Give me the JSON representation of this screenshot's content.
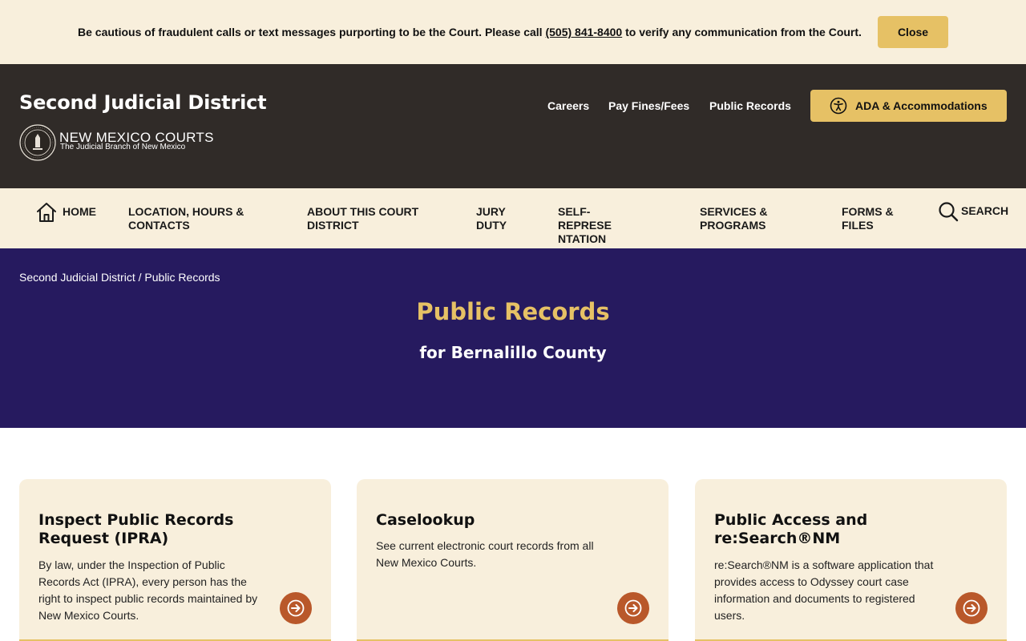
{
  "alert": {
    "text_before": "Be cautious of fraudulent calls or text messages purporting to be the Court. Please call ",
    "phone": "(505) 841-8400",
    "text_after": " to verify any communication from the Court.",
    "close_label": "Close"
  },
  "header": {
    "site_title": "Second Judicial District",
    "logo_title": "NEW MEXICO COURTS",
    "logo_subtitle": "The Judicial Branch of New Mexico",
    "utility_links": [
      "Careers",
      "Pay Fines/Fees",
      "Public Records"
    ],
    "ada_label": "ADA & Accommodations"
  },
  "nav": {
    "items": [
      "HOME",
      "LOCATION, HOURS & CONTACTS",
      "ABOUT THIS COURT DISTRICT",
      "JURY DUTY",
      "SELF-REPRESENTATION",
      "SERVICES & PROGRAMS",
      "FORMS & FILES"
    ],
    "search_label": "SEARCH"
  },
  "hero": {
    "breadcrumb": [
      "Second Judicial District",
      "Public Records"
    ],
    "breadcrumb_sep": " / ",
    "title": "Public Records",
    "subtitle": "for Bernalillo County"
  },
  "cards": [
    {
      "title": "Inspect Public Records Request (IPRA)",
      "description": "By law, under the Inspection of Public Records Act (IPRA), every person has the right to inspect public records maintained by New Mexico Courts."
    },
    {
      "title": "Caselookup",
      "description": "See current electronic court records from all New Mexico Courts."
    },
    {
      "title": "Public Access and re:Search®NM",
      "description": "re:Search®NM is a software application that provides access to Odyssey court case information and documents to registered users."
    }
  ],
  "colors": {
    "cream": "#f8efdc",
    "gold": "#e6c165",
    "header_dark": "#302b28",
    "hero_purple": "#261a5f",
    "arrow_orange": "#b9582a"
  }
}
